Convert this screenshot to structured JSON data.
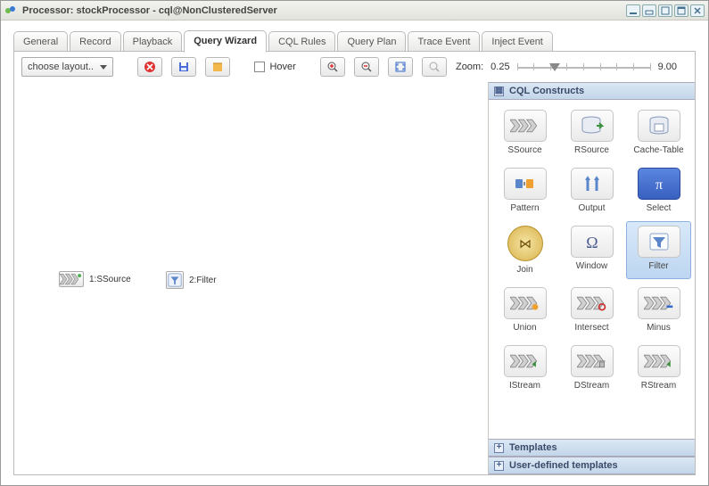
{
  "window": {
    "title": "Processor: stockProcessor - cql@NonClusteredServer"
  },
  "tabs": [
    "General",
    "Record",
    "Playback",
    "Query Wizard",
    "CQL Rules",
    "Query Plan",
    "Trace Event",
    "Inject Event"
  ],
  "activeTab": "Query Wizard",
  "toolbar": {
    "layout_label": "choose layout..",
    "hover_label": "Hover",
    "zoom_label": "Zoom:",
    "zoom_min": "0.25",
    "zoom_max": "9.00"
  },
  "canvas": {
    "nodes": [
      {
        "id": "ssource",
        "label": "1:SSource"
      },
      {
        "id": "filter",
        "label": "2:Filter"
      }
    ]
  },
  "palette": {
    "constructs_title": "CQL Constructs",
    "templates_title": "Templates",
    "user_templates_title": "User-defined templates",
    "items": [
      {
        "key": "ssource",
        "label": "SSource",
        "style": "chev"
      },
      {
        "key": "rsource",
        "label": "RSource",
        "style": "dbr"
      },
      {
        "key": "cachet",
        "label": "Cache-Table",
        "style": "db"
      },
      {
        "key": "pattern",
        "label": "Pattern",
        "style": "pattern"
      },
      {
        "key": "output",
        "label": "Output",
        "style": "output"
      },
      {
        "key": "select",
        "label": "Select",
        "style": "pi"
      },
      {
        "key": "join",
        "label": "Join",
        "style": "join"
      },
      {
        "key": "window",
        "label": "Window",
        "style": "omega"
      },
      {
        "key": "filter",
        "label": "Filter",
        "style": "filter",
        "selected": true
      },
      {
        "key": "union",
        "label": "Union",
        "style": "chev-orange"
      },
      {
        "key": "intersect",
        "label": "Intersect",
        "style": "chev-blue"
      },
      {
        "key": "minus",
        "label": "Minus",
        "style": "chev-minus"
      },
      {
        "key": "istream",
        "label": "IStream",
        "style": "chev-green"
      },
      {
        "key": "dstream",
        "label": "DStream",
        "style": "chev-trash"
      },
      {
        "key": "rstream",
        "label": "RStream",
        "style": "chev-up"
      }
    ]
  }
}
